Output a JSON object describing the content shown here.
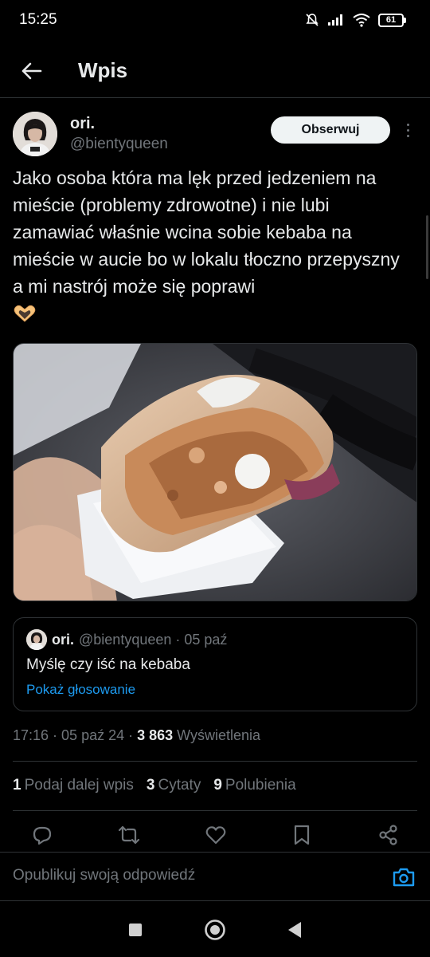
{
  "status_bar": {
    "time": "15:25",
    "battery": "61"
  },
  "header": {
    "title": "Wpis"
  },
  "post": {
    "author_name": "ori.",
    "author_handle": "@bientyqueen",
    "follow_label": "Obserwuj",
    "text": "Jako osoba która ma lęk przed jedzeniem na mieście (problemy zdrowotne) i nie lubi zamawiać właśnie wcina sobie kebaba na mieście w aucie bo w lokalu tłoczno przepyszny a mi nastrój może się poprawi",
    "emoji_icon": "heart-hands-icon"
  },
  "quote": {
    "author_name": "ori.",
    "meta": "@bientyqueen · 05 paź",
    "text": "Myślę czy iść na kebaba",
    "link": "Pokaż głosowanie"
  },
  "timestamp": {
    "time_date": "17:16 · 05 paź 24 · ",
    "views_count": "3 863",
    "views_label": " Wyświetlenia"
  },
  "stats": {
    "reposts_count": "1",
    "reposts_label": "Podaj dalej wpis",
    "quotes_count": "3",
    "quotes_label": "Cytaty",
    "likes_count": "9",
    "likes_label": "Polubienia"
  },
  "actions": [
    "reply-icon",
    "repost-icon",
    "like-icon",
    "bookmark-icon",
    "share-icon"
  ],
  "reply_bar": {
    "placeholder": "Opublikuj swoją odpowiedź"
  },
  "colors": {
    "background": "#000000",
    "text": "#e7e9ea",
    "muted": "#71767b",
    "accent": "#1d9bf0",
    "border": "#2f3336"
  }
}
